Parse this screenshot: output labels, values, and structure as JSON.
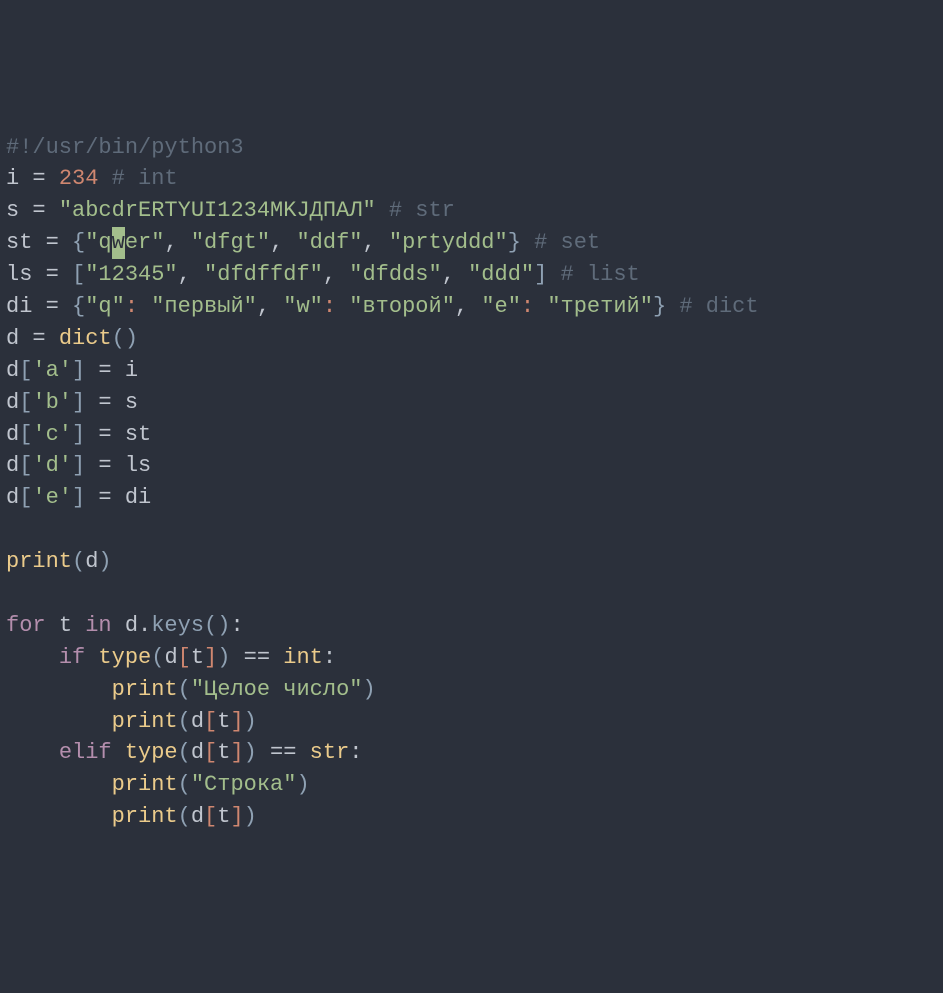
{
  "line1": {
    "shebang": "#!/usr/bin/python3"
  },
  "line2": {
    "var": "i",
    "eq": " = ",
    "num": "234",
    "sp": " ",
    "cmt": "# int"
  },
  "line3": {
    "var": "s",
    "eq": " = ",
    "str": "\"abcdrERTYUI1234MKJДПАЛ\"",
    "sp": " ",
    "cmt": "# str"
  },
  "line4": {
    "var": "st",
    "eq": " = ",
    "lb": "{",
    "s1a": "\"q",
    "cursor": "w",
    "s1b": "er\"",
    "c1": ", ",
    "s2": "\"dfgt\"",
    "c2": ", ",
    "s3": "\"ddf\"",
    "c3": ", ",
    "s4": "\"prtyddd\"",
    "rb": "}",
    "sp": " ",
    "cmt": "# set"
  },
  "line5": {
    "var": "ls",
    "eq": " = ",
    "lb": "[",
    "s1": "\"12345\"",
    "c1": ", ",
    "s2": "\"dfdffdf\"",
    "c2": ", ",
    "s3": "\"dfdds\"",
    "c3": ", ",
    "s4": "\"ddd\"",
    "rb": "]",
    "sp": " ",
    "cmt": "# list"
  },
  "line6": {
    "var": "di",
    "eq": " = ",
    "lb": "{",
    "k1": "\"q\"",
    "col": ":",
    "sp1": " ",
    "v1": "\"первый\"",
    "c1": ", ",
    "k2": "\"w\"",
    "sp2": " ",
    "v2": "\"второй\"",
    "c2": ", ",
    "k3": "\"e\"",
    "sp3": " ",
    "v3": "\"третий\"",
    "rb": "}",
    "sp": " ",
    "cmt": "# dict"
  },
  "line7": {
    "var": "d",
    "eq": " = ",
    "func": "dict",
    "lp": "(",
    "rp": ")"
  },
  "line8": {
    "var": "d",
    "lb": "[",
    "key": "'a'",
    "rb": "]",
    "eq": " = ",
    "rhs": "i"
  },
  "line9": {
    "var": "d",
    "lb": "[",
    "key": "'b'",
    "rb": "]",
    "eq": " = ",
    "rhs": "s"
  },
  "line10": {
    "var": "d",
    "lb": "[",
    "key": "'c'",
    "rb": "]",
    "eq": " = ",
    "rhs": "st"
  },
  "line11": {
    "var": "d",
    "lb": "[",
    "key": "'d'",
    "rb": "]",
    "eq": " = ",
    "rhs": "ls"
  },
  "line12": {
    "var": "d",
    "lb": "[",
    "key": "'e'",
    "rb": "]",
    "eq": " = ",
    "rhs": "di"
  },
  "line14": {
    "func": "print",
    "lp": "(",
    "arg": "d",
    "rp": ")"
  },
  "line16": {
    "kfor": "for",
    "sp1": " ",
    "t": "t",
    "sp2": " ",
    "kin": "in",
    "sp3": " ",
    "d": "d",
    "dot": ".",
    "keys": "keys",
    "lp": "(",
    "rp": ")",
    "col": ":"
  },
  "line17": {
    "indent": "    ",
    "kif": "if",
    "sp1": " ",
    "type": "type",
    "lp": "(",
    "d": "d",
    "lb": "[",
    "t": "t",
    "rb": "]",
    "rp": ")",
    "eq": " == ",
    "int": "int",
    "col": ":"
  },
  "line18": {
    "indent": "        ",
    "func": "print",
    "lp": "(",
    "str": "\"Целое число\"",
    "rp": ")"
  },
  "line19": {
    "indent": "        ",
    "func": "print",
    "lp": "(",
    "d": "d",
    "lb": "[",
    "t": "t",
    "rb": "]",
    "rp": ")"
  },
  "line20": {
    "indent": "    ",
    "kelif": "elif",
    "sp1": " ",
    "type": "type",
    "lp": "(",
    "d": "d",
    "lb": "[",
    "t": "t",
    "rb": "]",
    "rp": ")",
    "eq": " == ",
    "str": "str",
    "col": ":"
  },
  "line21": {
    "indent": "        ",
    "func": "print",
    "lp": "(",
    "str": "\"Строка\"",
    "rp": ")"
  },
  "line22": {
    "indent": "        ",
    "func": "print",
    "lp": "(",
    "d": "d",
    "lb": "[",
    "t": "t",
    "rb": "]",
    "rp": ")"
  }
}
